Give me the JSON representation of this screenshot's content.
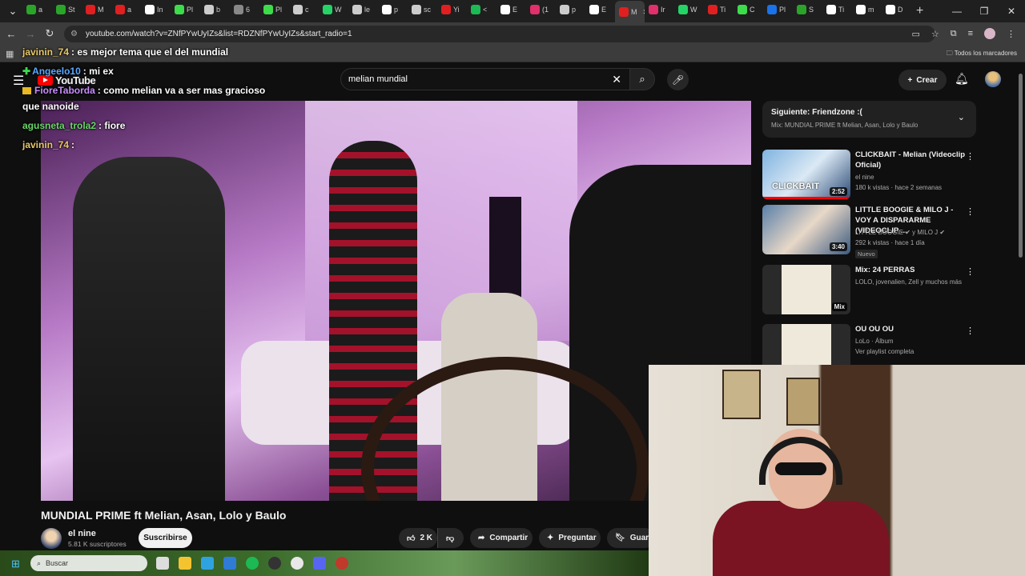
{
  "browser": {
    "tabs": [
      {
        "label": "a",
        "color": "#2aa52a"
      },
      {
        "label": "St",
        "color": "#2aa52a"
      },
      {
        "label": "M",
        "color": "#e02020"
      },
      {
        "label": "a",
        "color": "#e02020"
      },
      {
        "label": "In",
        "color": "#ffffff"
      },
      {
        "label": "Pl",
        "color": "#3ddc4b"
      },
      {
        "label": "b",
        "color": "#cccccc"
      },
      {
        "label": "6",
        "color": "#888888"
      },
      {
        "label": "Pl",
        "color": "#3ddc4b"
      },
      {
        "label": "c",
        "color": "#cccccc"
      },
      {
        "label": "W",
        "color": "#25d366"
      },
      {
        "label": "le",
        "color": "#cccccc"
      },
      {
        "label": "p",
        "color": "#ffffff"
      },
      {
        "label": "sc",
        "color": "#cccccc"
      },
      {
        "label": "Yi",
        "color": "#e02020"
      },
      {
        "label": "<",
        "color": "#1db954"
      },
      {
        "label": "E",
        "color": "#ffffff"
      },
      {
        "label": "(1",
        "color": "#e1306c"
      },
      {
        "label": "p",
        "color": "#cccccc"
      },
      {
        "label": "E",
        "color": "#ffffff"
      },
      {
        "label": "M",
        "color": "#e02020",
        "active": true
      },
      {
        "label": "Ir",
        "color": "#e1306c"
      },
      {
        "label": "W",
        "color": "#25d366"
      },
      {
        "label": "Ti",
        "color": "#e02020"
      },
      {
        "label": "C",
        "color": "#3ddc4b"
      },
      {
        "label": "Pl",
        "color": "#1a73e8"
      },
      {
        "label": "S",
        "color": "#2aa52a"
      },
      {
        "label": "Ti",
        "color": "#ffffff"
      },
      {
        "label": "m",
        "color": "#ffffff"
      },
      {
        "label": "D",
        "color": "#ffffff"
      }
    ],
    "new_tab_icon": "+",
    "url": "youtube.com/watch?v=ZNfPYwUyIZs&list=RDZNfPYwUyIZs&start_radio=1",
    "bookmarks_label": "Todos los marcadores"
  },
  "youtube": {
    "logo_text": "YouTube",
    "search_value": "melian mundial",
    "create_label": "Crear",
    "video_title": "MUNDIAL PRIME ft Melian, Asan, Lolo y Baulo",
    "channel_name": "el nine",
    "channel_subs": "5.81 K suscriptores",
    "subscribe_label": "Suscribirse",
    "like_count": "2 K",
    "share_label": "Compartir",
    "ask_label": "Preguntar",
    "save_label": "Guardar"
  },
  "chat": [
    {
      "name": "javinin_74",
      "text": ": es mejor tema que el del mundial",
      "color": "#e8c86a"
    },
    {
      "name": "Angeelo10",
      "text": ": mi ex",
      "color": "#5aa8ff"
    },
    {
      "name": "FioreTaborda",
      "text": ": como melian va a ser mas gracioso",
      "color": "#c88cff"
    },
    {
      "name": "",
      "text": "que nanoide",
      "color": "#ffffff"
    },
    {
      "name": "agusneta_trola2",
      "text": ": fiore",
      "color": "#6ad66a"
    },
    {
      "name": "javinin_74",
      "text": ":",
      "color": "#e8c86a"
    }
  ],
  "queue": {
    "next_label": "Siguiente: Friendzone :(",
    "mix_label": "Mix: MUNDIAL PRIME ft Melian, Asan, Lolo y Baulo"
  },
  "recommendations": [
    {
      "title": "CLICKBAIT - Melian (Videoclip Oficial)",
      "channel": "el nine",
      "meta": "180 k vistas · hace 2 semanas",
      "duration": "2:52",
      "thumb_text": "CLICKBAIT",
      "badge": ""
    },
    {
      "title": "LITTLE BOOGIE & MILO J - VOY A DISPARARME (VIDEOCLIP ...",
      "channel": "LITTLE BOOGIE ✔ y MILO J ✔",
      "meta": "292 k vistas · hace 1 día",
      "duration": "3:40",
      "thumb_text": "",
      "badge": "Nuevo"
    },
    {
      "title": "Mix: 24 PERRAS",
      "channel": "LOLO, jovenalien, Zell y muchos más",
      "meta": "",
      "duration": "Mix",
      "thumb_text": "",
      "badge": ""
    },
    {
      "title": "OU OU OU",
      "channel": "LoLo · Álbum",
      "meta": "Ver playlist completa",
      "duration": "",
      "thumb_text": "",
      "badge": ""
    }
  ],
  "taskbar": {
    "search_placeholder": "Buscar"
  }
}
